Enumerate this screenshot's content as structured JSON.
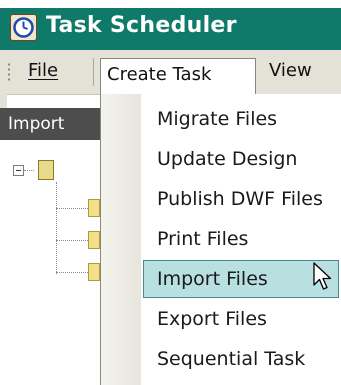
{
  "window": {
    "title": "Task Scheduler",
    "icon": "clock-icon"
  },
  "menubar": {
    "file": "File",
    "create_task": "Create Task",
    "view": "View"
  },
  "left_pane": {
    "header": "Import"
  },
  "dropdown": {
    "items": [
      {
        "label": "Migrate Files"
      },
      {
        "label": "Update Design"
      },
      {
        "label": "Publish DWF Files"
      },
      {
        "label": "Print Files"
      },
      {
        "label": "Import Files",
        "highlighted": true
      },
      {
        "label": "Export Files"
      },
      {
        "label": "Sequential Task"
      }
    ]
  },
  "colors": {
    "titlebar": "#0f7a6a",
    "menubar": "#e4e1d6",
    "highlight": "#b8e0e0",
    "highlight_border": "#4a8c8c",
    "pane_header": "#4d4d4d"
  }
}
